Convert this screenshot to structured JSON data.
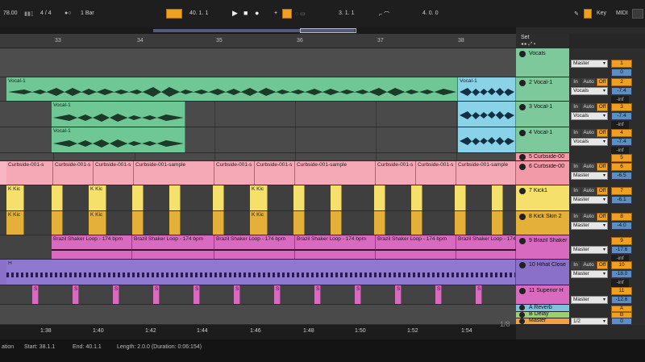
{
  "transport": {
    "tempo": "78.00",
    "signature": "4 / 4",
    "quantize": "1 Bar",
    "position": "40.  1.  1",
    "loop_start": "3.  1.  1",
    "loop_length": "4.  0.  0",
    "key_label": "Key",
    "midi_label": "MIDI"
  },
  "ruler": {
    "bars": [
      "33",
      "34",
      "35",
      "36",
      "37",
      "38"
    ],
    "set_label": "Set"
  },
  "time_ruler": {
    "labels": [
      "1:38",
      "1:40",
      "1:42",
      "1:44",
      "1:46",
      "1:48",
      "1:50",
      "1:52",
      "1:54"
    ],
    "page": "1/8"
  },
  "clips": {
    "vocal1": "Vocal-1",
    "curbside_short": "Curbside-001-s",
    "curbside_long": "Curbside-001-sample",
    "kick": "K Kic",
    "shaker": "Brazil Shaker Loop - 174 bpm",
    "hihat": "H",
    "sup": "S"
  },
  "tracks": [
    {
      "name": "Vocals",
      "color": "#7dc99b"
    },
    {
      "name": "2 Vocal-1",
      "color": "#7dc99b"
    },
    {
      "name": "3 Vocal-1",
      "color": "#7dc99b"
    },
    {
      "name": "4 Vocal-1",
      "color": "#7dc99b"
    },
    {
      "name": "5 Curbside-00",
      "color": "#f29aa8"
    },
    {
      "name": "6 Curbside-00",
      "color": "#f29aa8"
    },
    {
      "name": "7 Kick1",
      "color": "#f4e06a"
    },
    {
      "name": "8 Kick Skin 2",
      "color": "#e4b03a"
    },
    {
      "name": "9 Brazil Shaker",
      "color": "#d86bc0"
    },
    {
      "name": "10 Hihat Close",
      "color": "#8a70c8"
    },
    {
      "name": "11 Superior H",
      "color": "#d86bc0"
    },
    {
      "name": "A Reverb",
      "color": "#7cc3dc"
    },
    {
      "name": "B Delay",
      "color": "#9ad36d"
    },
    {
      "name": "Master",
      "color": "#f4a040"
    }
  ],
  "mixer": {
    "master": "Master",
    "vocals": "Vocals",
    "in": "In",
    "auto": "Auto",
    "off": "Off",
    "inf": "-inf",
    "half": "1/2",
    "nums": [
      "1",
      "2",
      "3",
      "4",
      "5",
      "6",
      "7",
      "8",
      "9",
      "10",
      "11",
      "A",
      "B",
      "0"
    ],
    "vols": [
      "0",
      "-7.4",
      "-7.4",
      "-7.4",
      "-6.5",
      "-6.1",
      "-4.0",
      "-17.6",
      "-18.0",
      "-12.6",
      "0"
    ]
  },
  "status": {
    "mode": "ation",
    "start": "Start: 38.1.1",
    "end": "End: 40.1.1",
    "length": "Length: 2.0.0  (Duration: 0:06:154)"
  }
}
